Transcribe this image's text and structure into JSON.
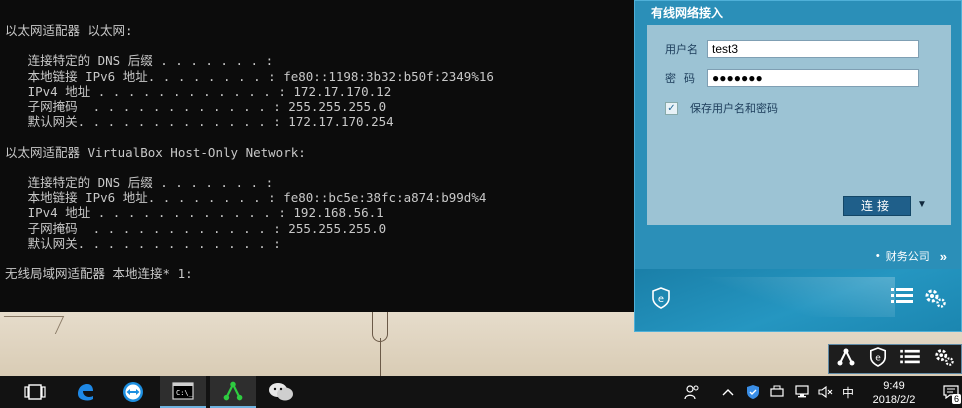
{
  "console": {
    "lines": [
      "以太网适配器 以太网:",
      "",
      "   连接特定的 DNS 后缀 . . . . . . . :",
      "   本地链接 IPv6 地址. . . . . . . . : fe80::1198:3b32:b50f:2349%16",
      "   IPv4 地址 . . . . . . . . . . . . : 172.17.170.12",
      "   子网掩码  . . . . . . . . . . . . : 255.255.255.0",
      "   默认网关. . . . . . . . . . . . . : 172.17.170.254",
      "",
      "以太网适配器 VirtualBox Host-Only Network:",
      "",
      "   连接特定的 DNS 后缀 . . . . . . . :",
      "   本地链接 IPv6 地址. . . . . . . . : fe80::bc5e:38fc:a874:b99d%4",
      "   IPv4 地址 . . . . . . . . . . . . : 192.168.56.1",
      "   子网掩码  . . . . . . . . . . . . : 255.255.255.0",
      "   默认网关. . . . . . . . . . . . . :",
      "",
      "无线局域网适配器 本地连接* 1:"
    ]
  },
  "client": {
    "title": "有线网络接入",
    "username_label": "用户名",
    "username_value": "test3",
    "password_label": "密码",
    "password_value": "●●●●●●●",
    "save_label": "保存用户名和密码",
    "save_checked": "✓",
    "connect_label": "连接",
    "connect_caret": "▼",
    "company_dot": "•",
    "company_label": "财务公司",
    "company_chevron": "»",
    "footer_icons": [
      "shield-e-icon",
      "list-icon",
      "gear-icon"
    ]
  },
  "tray_popup": {
    "icons": [
      "network-client-icon",
      "shield-e-icon",
      "list-icon",
      "gear-icon"
    ]
  },
  "taskbar": {
    "apps": [
      "task-view-icon",
      "edge-icon",
      "teamviewer-icon",
      "cmd-icon",
      "network-client-icon",
      "wechat-icon"
    ],
    "tray_text": {
      "ime": "中"
    },
    "clock_time": "9:49",
    "clock_date": "2018/2/2",
    "notification_count": "6"
  },
  "colors": {
    "console_bg": "#0c0c0c",
    "client_accent": "#2b8fb8",
    "connect_button": "#1f5f8a"
  }
}
